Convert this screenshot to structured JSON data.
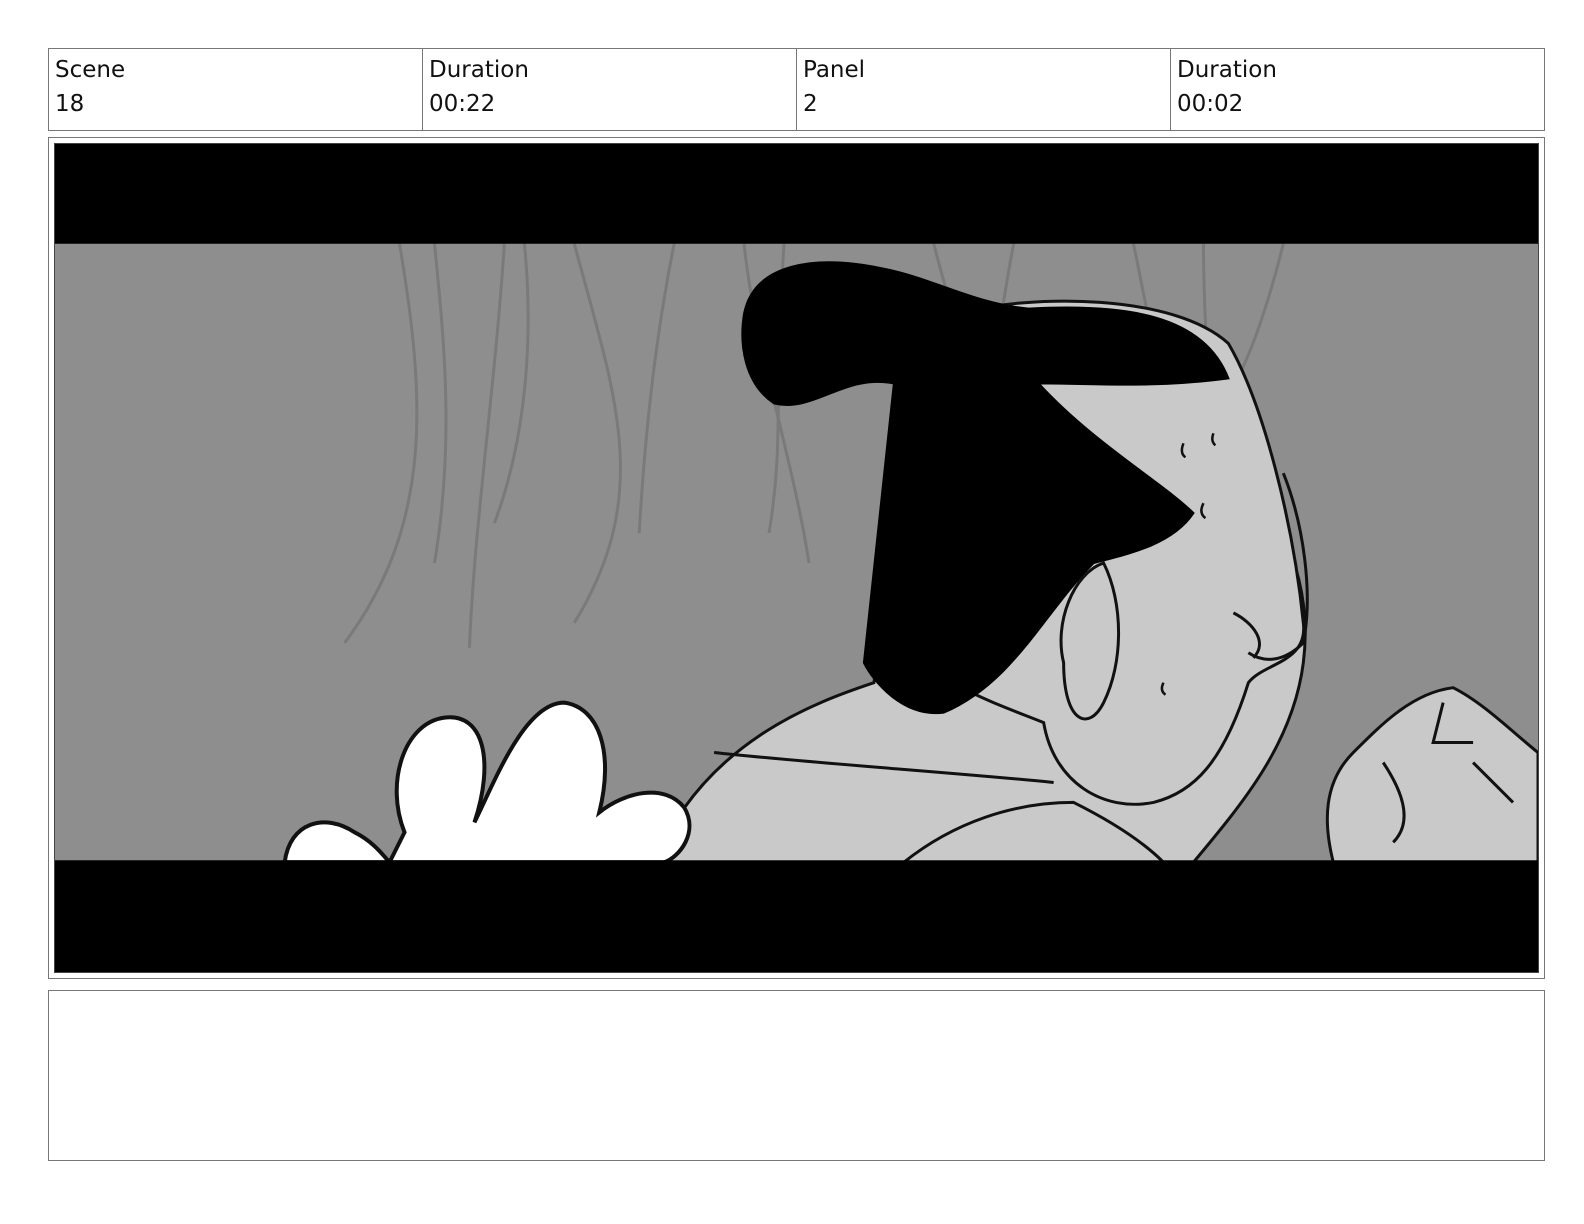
{
  "header": {
    "scene_label": "Scene",
    "scene_value": "18",
    "scene_duration_label": "Duration",
    "scene_duration_value": "00:22",
    "panel_label": "Panel",
    "panel_value": "2",
    "panel_duration_label": "Duration",
    "panel_duration_value": "00:02"
  },
  "notes": {
    "text": ""
  }
}
